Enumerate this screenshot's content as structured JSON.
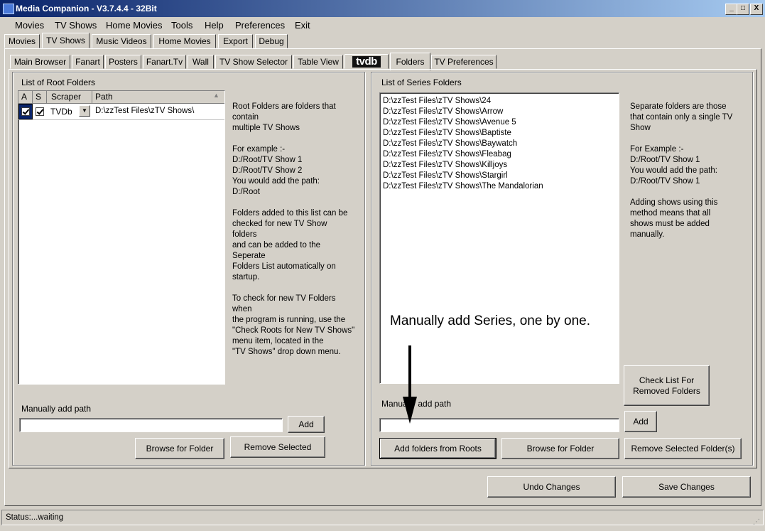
{
  "window": {
    "title": "Media Companion - V3.7.4.4 - 32Bit",
    "min": "_",
    "max": "□",
    "close": "X"
  },
  "menu": [
    "Movies",
    "TV Shows",
    "Home Movies",
    "Tools",
    "Help",
    "Preferences",
    "Exit"
  ],
  "main_tabs": [
    "Movies",
    "TV Shows",
    "Music Videos",
    "Home Movies",
    "Export",
    "Debug"
  ],
  "sub_tabs": [
    "Main Browser",
    "Fanart",
    "Posters",
    "Fanart.Tv",
    "Wall",
    "TV Show Selector",
    "Table View",
    "tvdb",
    "Folders",
    "TV Preferences"
  ],
  "left": {
    "group_title": "List of Root Folders",
    "columns": [
      "A",
      "S",
      "Scraper",
      "Path"
    ],
    "row": {
      "scraper": "TVDb",
      "path": "D:\\zzTest Files\\zTV Shows\\"
    },
    "description": "Root Folders are folders that\ncontain\nmultiple TV Shows\n\nFor example :-\nD:/Root/TV Show 1\nD:/Root/TV Show 2\nYou would add the path:\nD:/Root\n\nFolders added to this list can be\nchecked for new TV Show\nfolders\nand can be added to the\nSeperate\nFolders List automatically on\nstartup.\n\nTo check for new TV Folders\nwhen\nthe program is running, use the\n\"Check Roots for New TV Shows\"\nmenu item, located in the\n\"TV Shows\" drop down menu.",
    "manual_label": "Manually add path",
    "add": "Add",
    "browse": "Browse for Folder",
    "remove": "Remove Selected"
  },
  "right": {
    "group_title": "List of Series Folders",
    "folders": [
      "D:\\zzTest Files\\zTV Shows\\24",
      "D:\\zzTest Files\\zTV Shows\\Arrow",
      "D:\\zzTest Files\\zTV Shows\\Avenue 5",
      "D:\\zzTest Files\\zTV Shows\\Baptiste",
      "D:\\zzTest Files\\zTV Shows\\Baywatch",
      "D:\\zzTest Files\\zTV Shows\\Fleabag",
      "D:\\zzTest Files\\zTV Shows\\Killjoys",
      "D:\\zzTest Files\\zTV Shows\\Stargirl",
      "D:\\zzTest Files\\zTV Shows\\The Mandalorian"
    ],
    "description": "Separate folders are those\nthat contain only a single TV\nShow\n\nFor Example :-\nD:/Root/TV Show 1\nYou would add the path:\nD:/Root/TV Show 1\n\nAdding shows using this\nmethod means that all\nshows must be added\nmanually.",
    "annotation": "Manually add Series, one by one.",
    "check_removed": "Check List For\nRemoved Folders",
    "manual_label": "Manually add path",
    "add": "Add",
    "add_from_roots": "Add folders from Roots",
    "browse": "Browse for Folder",
    "remove": "Remove Selected Folder(s)"
  },
  "bottom": {
    "undo": "Undo Changes",
    "save": "Save Changes"
  },
  "status": "Status:...waiting"
}
